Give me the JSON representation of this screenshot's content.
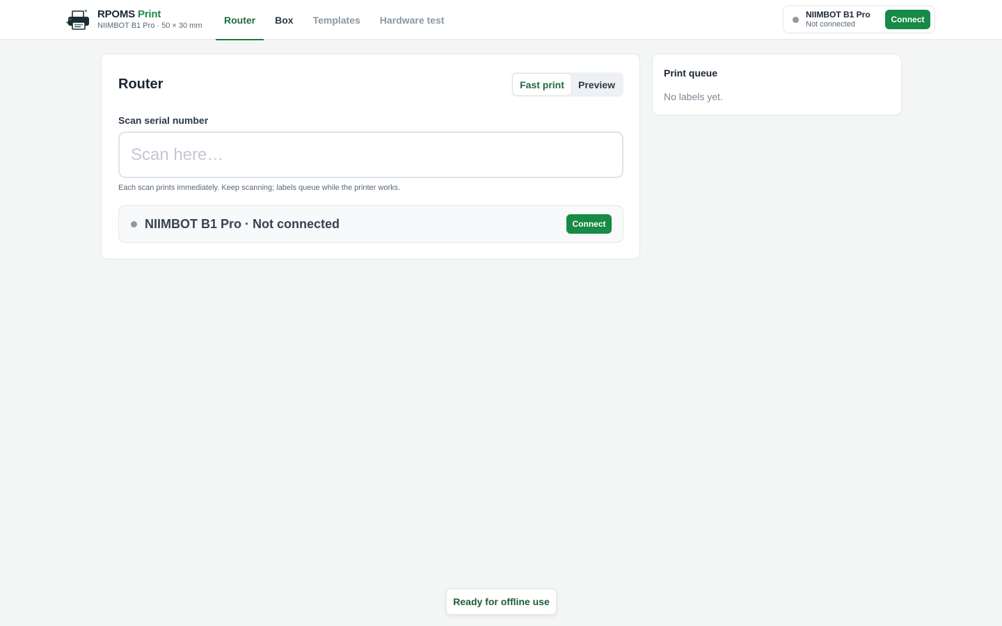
{
  "app": {
    "title_main": "RPOMS",
    "title_accent": "Print",
    "subtitle": "NIIMBOT B1 Pro · 50 × 30 mm",
    "logo_icon": "printer-logo-icon"
  },
  "nav": {
    "tabs": [
      {
        "label": "Router",
        "active": true
      },
      {
        "label": "Box",
        "active": false
      },
      {
        "label": "Templates",
        "active": false
      },
      {
        "label": "Hardware test",
        "active": false
      }
    ]
  },
  "header_printer": {
    "name": "NIIMBOT B1 Pro",
    "status": "Not connected",
    "connect_label": "Connect"
  },
  "router_card": {
    "title": "Router",
    "mode_fast": "Fast print",
    "mode_preview": "Preview",
    "selected_mode": "Fast print",
    "scan_label": "Scan serial number",
    "scan_placeholder": "Scan here…",
    "scan_value": "",
    "hint": "Each scan prints immediately. Keep scanning; labels queue while the printer works.",
    "printer_status": "NIIMBOT B1 Pro · Not connected",
    "connect_label": "Connect"
  },
  "queue": {
    "title": "Print queue",
    "empty_text": "No labels yet."
  },
  "toast": {
    "text": "Ready for offline use"
  },
  "colors": {
    "accent": "#178a45",
    "accent_text": "#1c6b3f",
    "status_dot": "#8e99a4",
    "background": "#f4f6f5"
  }
}
